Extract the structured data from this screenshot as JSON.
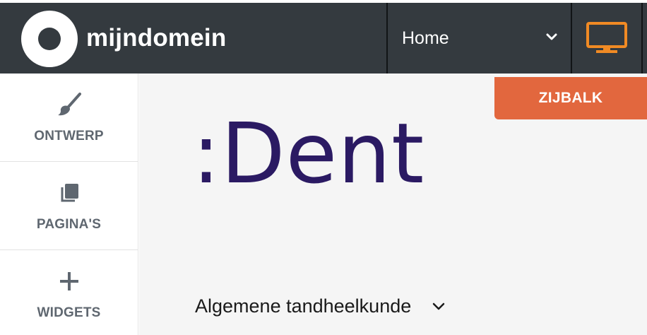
{
  "header": {
    "logo_text": "mijndomein",
    "page_select_value": "Home"
  },
  "sidebar": {
    "items": [
      {
        "label": "ONTWERP",
        "icon": "brush-icon"
      },
      {
        "label": "PAGINA'S",
        "icon": "pages-icon"
      },
      {
        "label": "WIDGETS",
        "icon": "plus-icon"
      }
    ]
  },
  "canvas": {
    "sidebar_button_label": "ZIJBALK",
    "brand_logo_text": ":Dent",
    "menu_item_label": "Algemene tandheelkunde"
  },
  "colors": {
    "header_bg": "#343a3f",
    "accent_orange": "#e2673e",
    "device_icon": "#f08a24",
    "brand_purple": "#2b1a63"
  }
}
